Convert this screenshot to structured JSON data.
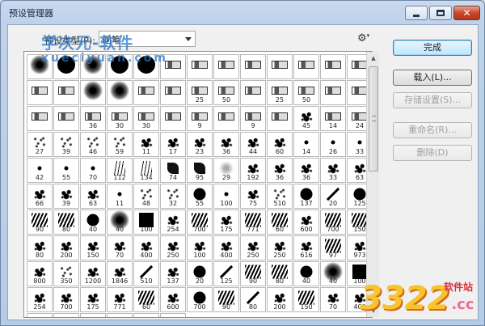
{
  "window": {
    "title": "预设管理器",
    "close_glyph": "✕"
  },
  "preset_type": {
    "label": "预设类型(P):",
    "value": "画笔"
  },
  "buttons": {
    "done": "完成",
    "load": "载入(L)...",
    "save": "存储设置(S)...",
    "rename": "重命名(R)...",
    "delete": "删除(D)"
  },
  "brushes": [
    {
      "s": "soft",
      "n": ""
    },
    {
      "s": "hard",
      "n": ""
    },
    {
      "s": "soft",
      "n": ""
    },
    {
      "s": "hard",
      "n": ""
    },
    {
      "s": "hard",
      "n": ""
    },
    {
      "s": "tool",
      "n": ""
    },
    {
      "s": "tool",
      "n": ""
    },
    {
      "s": "tool",
      "n": ""
    },
    {
      "s": "tool",
      "n": ""
    },
    {
      "s": "tool",
      "n": ""
    },
    {
      "s": "tool",
      "n": ""
    },
    {
      "s": "tool",
      "n": ""
    },
    {
      "s": "tool",
      "n": ""
    },
    {
      "s": "tool",
      "n": ""
    },
    {
      "s": "tool",
      "n": ""
    },
    {
      "s": "soft",
      "n": ""
    },
    {
      "s": "soft",
      "n": ""
    },
    {
      "s": "tool",
      "n": ""
    },
    {
      "s": "tool",
      "n": ""
    },
    {
      "s": "tool",
      "n": "25"
    },
    {
      "s": "tool",
      "n": "50"
    },
    {
      "s": "tool",
      "n": ""
    },
    {
      "s": "tool",
      "n": "25"
    },
    {
      "s": "tool",
      "n": "50"
    },
    {
      "s": "tool",
      "n": ""
    },
    {
      "s": "tool",
      "n": ""
    },
    {
      "s": "tool",
      "n": ""
    },
    {
      "s": "tool",
      "n": ""
    },
    {
      "s": "tool",
      "n": "36"
    },
    {
      "s": "tool",
      "n": "30"
    },
    {
      "s": "tool",
      "n": "30"
    },
    {
      "s": "tool",
      "n": ""
    },
    {
      "s": "tool",
      "n": "9"
    },
    {
      "s": "tool",
      "n": ""
    },
    {
      "s": "tool",
      "n": "9"
    },
    {
      "s": "tool",
      "n": ""
    },
    {
      "s": "splat",
      "n": "45"
    },
    {
      "s": "tool",
      "n": "14"
    },
    {
      "s": "tool",
      "n": "24"
    },
    {
      "s": "scatter",
      "n": "27"
    },
    {
      "s": "scatter",
      "n": "39"
    },
    {
      "s": "scatter",
      "n": "46"
    },
    {
      "s": "scatter",
      "n": "59"
    },
    {
      "s": "splat",
      "n": "11"
    },
    {
      "s": "splat",
      "n": "17"
    },
    {
      "s": "splat",
      "n": "23"
    },
    {
      "s": "splat",
      "n": "36"
    },
    {
      "s": "splat",
      "n": "44"
    },
    {
      "s": "splat",
      "n": "60"
    },
    {
      "s": "dot",
      "n": "14"
    },
    {
      "s": "dot",
      "n": "26"
    },
    {
      "s": "dot",
      "n": "33"
    },
    {
      "s": "dot",
      "n": "42"
    },
    {
      "s": "dot",
      "n": "55"
    },
    {
      "s": "dot",
      "n": "70"
    },
    {
      "s": "grass",
      "n": "112"
    },
    {
      "s": "grass",
      "n": "134"
    },
    {
      "s": "leaf",
      "n": "74"
    },
    {
      "s": "leaf",
      "n": "95"
    },
    {
      "s": "light",
      "n": "29"
    },
    {
      "s": "splat",
      "n": "192"
    },
    {
      "s": "splat",
      "n": "36"
    },
    {
      "s": "splat",
      "n": "36"
    },
    {
      "s": "splat",
      "n": "33"
    },
    {
      "s": "splat",
      "n": "63"
    },
    {
      "s": "splat",
      "n": "66"
    },
    {
      "s": "splat",
      "n": "39"
    },
    {
      "s": "splat",
      "n": "63"
    },
    {
      "s": "dot",
      "n": "11"
    },
    {
      "s": "scatter",
      "n": "48"
    },
    {
      "s": "scatter",
      "n": "32"
    },
    {
      "s": "hard-sm",
      "n": "55"
    },
    {
      "s": "dot",
      "n": "100"
    },
    {
      "s": "splat",
      "n": "75"
    },
    {
      "s": "scatter",
      "n": "510"
    },
    {
      "s": "hard-sm",
      "n": "137"
    },
    {
      "s": "stroke",
      "n": "20"
    },
    {
      "s": "hard-sm",
      "n": "125"
    },
    {
      "s": "block",
      "n": "90"
    },
    {
      "s": "block",
      "n": "80"
    },
    {
      "s": "hard-sm",
      "n": "40"
    },
    {
      "s": "soft",
      "n": "40"
    },
    {
      "s": "square",
      "n": "100"
    },
    {
      "s": "splat",
      "n": "254"
    },
    {
      "s": "block",
      "n": "700"
    },
    {
      "s": "splat",
      "n": "175"
    },
    {
      "s": "block",
      "n": "771"
    },
    {
      "s": "block",
      "n": "60"
    },
    {
      "s": "splat",
      "n": "600"
    },
    {
      "s": "block",
      "n": "700"
    },
    {
      "s": "block",
      "n": "150"
    },
    {
      "s": "splat",
      "n": "80"
    },
    {
      "s": "splat",
      "n": "200"
    },
    {
      "s": "splat",
      "n": "150"
    },
    {
      "s": "splat",
      "n": "70"
    },
    {
      "s": "splat",
      "n": "400"
    },
    {
      "s": "splat",
      "n": "250"
    },
    {
      "s": "splat",
      "n": "100"
    },
    {
      "s": "splat",
      "n": "400"
    },
    {
      "s": "splat",
      "n": "250"
    },
    {
      "s": "splat",
      "n": "250"
    },
    {
      "s": "splat",
      "n": "616"
    },
    {
      "s": "block",
      "n": "97"
    },
    {
      "s": "splat",
      "n": "973"
    },
    {
      "s": "splat",
      "n": "800"
    },
    {
      "s": "scatter",
      "n": "350"
    },
    {
      "s": "splat",
      "n": "1200"
    },
    {
      "s": "splat",
      "n": "1846"
    },
    {
      "s": "stroke",
      "n": "510"
    },
    {
      "s": "splat",
      "n": "137"
    },
    {
      "s": "hard-sm",
      "n": "20"
    },
    {
      "s": "stroke",
      "n": "125"
    },
    {
      "s": "block",
      "n": "90"
    },
    {
      "s": "block",
      "n": "80"
    },
    {
      "s": "hard-sm",
      "n": "40"
    },
    {
      "s": "soft",
      "n": "40"
    },
    {
      "s": "square",
      "n": "100"
    },
    {
      "s": "splat",
      "n": "254"
    },
    {
      "s": "splat",
      "n": "700"
    },
    {
      "s": "splat",
      "n": "175"
    },
    {
      "s": "splat",
      "n": "771"
    },
    {
      "s": "block",
      "n": "60"
    },
    {
      "s": "splat",
      "n": "600"
    },
    {
      "s": "hard-sm",
      "n": "700"
    },
    {
      "s": "block",
      "n": "90"
    },
    {
      "s": "stroke",
      "n": "80"
    },
    {
      "s": "splat",
      "n": "200"
    },
    {
      "s": "block",
      "n": "150"
    },
    {
      "s": "splat",
      "n": "70"
    },
    {
      "s": "splat",
      "n": "400"
    },
    {
      "s": "splat",
      "n": "250"
    },
    {
      "s": "splat",
      "n": "250"
    },
    {
      "s": "splat",
      "n": "400"
    },
    {
      "s": "splat",
      "n": "400"
    },
    {
      "s": "splat",
      "n": "800"
    },
    {
      "s": "splat",
      "n": ""
    }
  ],
  "watermarks": {
    "top_text": "学次元-软件",
    "top_sub": "xueciyuan.com",
    "bottom_num": "3322",
    "bottom_cc": ".cc",
    "bottom_site": "软件站"
  },
  "colors": {
    "title_bg": "#bfd2ea",
    "close_red": "#c8462c",
    "primary_button": "#bee6fd"
  }
}
